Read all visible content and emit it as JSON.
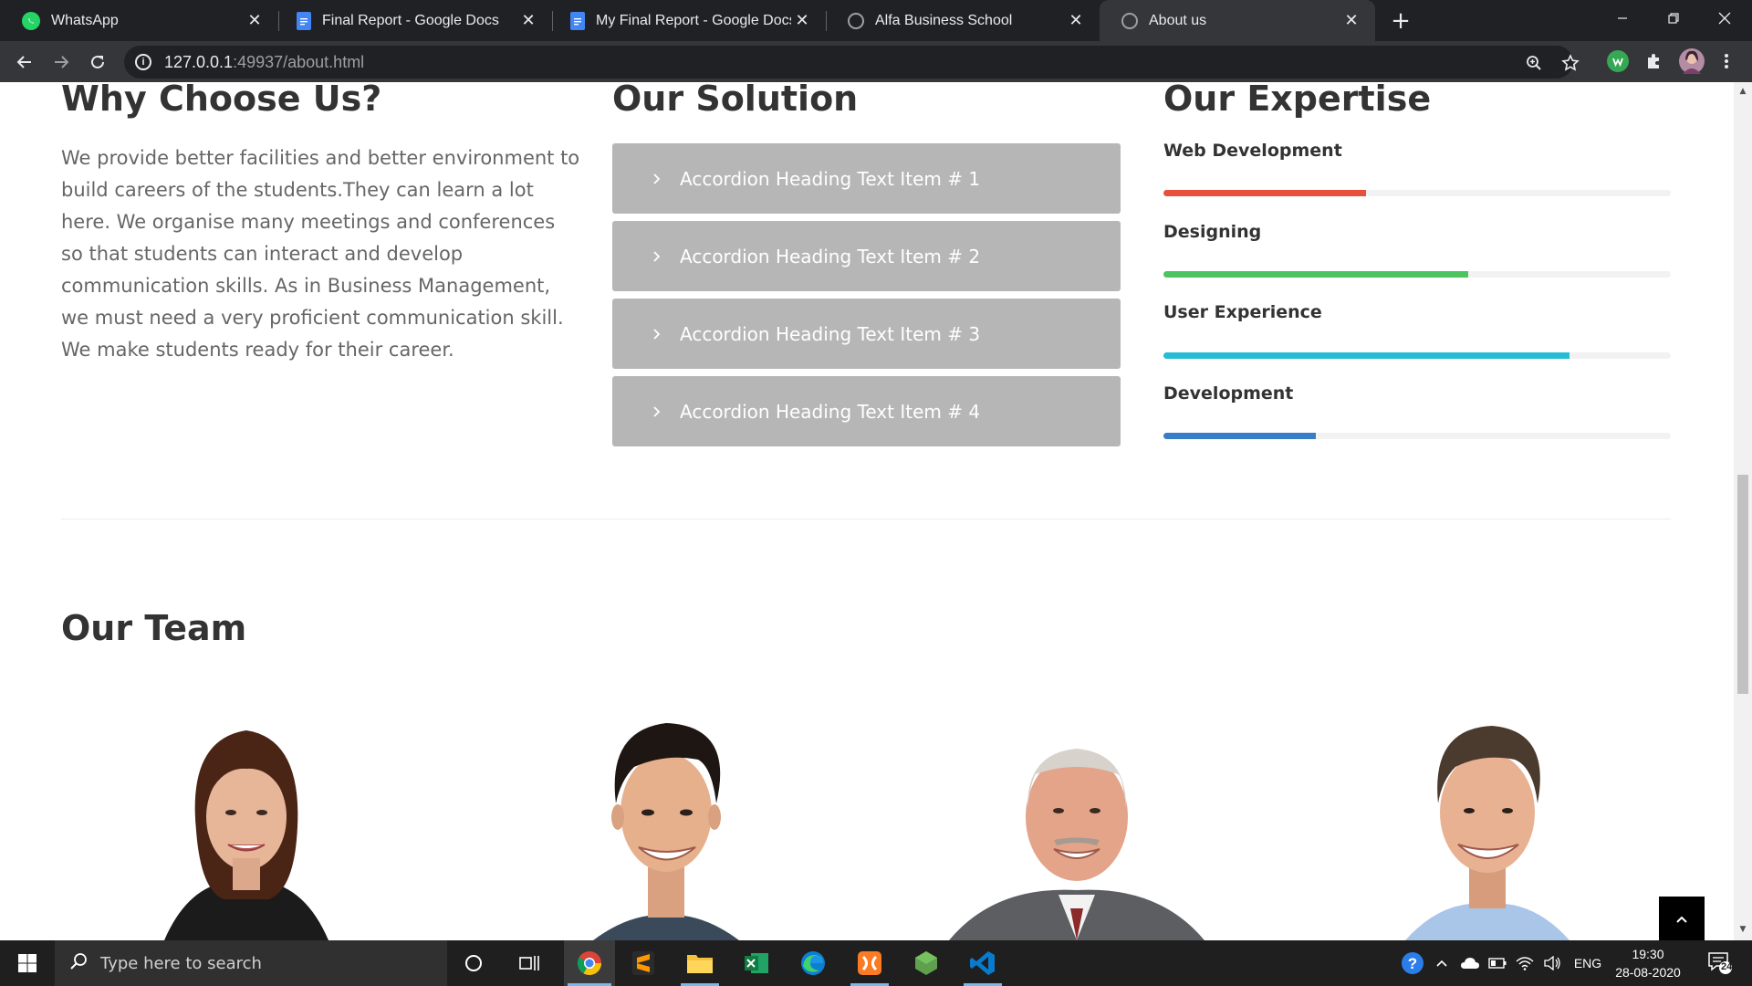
{
  "browser": {
    "tabs": [
      {
        "title": "WhatsApp",
        "icon": "whatsapp-icon"
      },
      {
        "title": "Final Report - Google Docs",
        "icon": "google-docs-icon"
      },
      {
        "title": "My Final Report - Google Docs",
        "icon": "google-docs-icon"
      },
      {
        "title": "Alfa Business School",
        "icon": "globe-icon"
      },
      {
        "title": "About us",
        "icon": "globe-icon",
        "active": true
      }
    ],
    "url_host": "127.0.0.1",
    "url_rest": ":49937/about.html"
  },
  "why": {
    "heading": "Why Choose Us?",
    "text": "We provide better facilities and better environment to build careers of the students.They can learn a lot here. We organise many meetings and conferences so that students can interact and develop communication skills. As in Business Management, we must need a very proficient communication skill. We make students ready for their career."
  },
  "solution": {
    "heading": "Our Solution",
    "items": [
      "Accordion Heading Text Item # 1",
      "Accordion Heading Text Item # 2",
      "Accordion Heading Text Item # 3",
      "Accordion Heading Text Item # 4"
    ]
  },
  "expertise": {
    "heading": "Our Expertise",
    "skills": [
      {
        "label": "Web Development",
        "percent": 40,
        "color": "#e8503e"
      },
      {
        "label": "Designing",
        "percent": 60,
        "color": "#4cc45f"
      },
      {
        "label": "User Experience",
        "percent": 80,
        "color": "#26bcd3"
      },
      {
        "label": "Development",
        "percent": 30,
        "color": "#3a7dc7"
      }
    ]
  },
  "team": {
    "heading": "Our Team"
  },
  "taskbar": {
    "search_placeholder": "Type here to search",
    "language": "ENG",
    "time": "19:30",
    "date": "28-08-2020",
    "notifications": "24"
  }
}
